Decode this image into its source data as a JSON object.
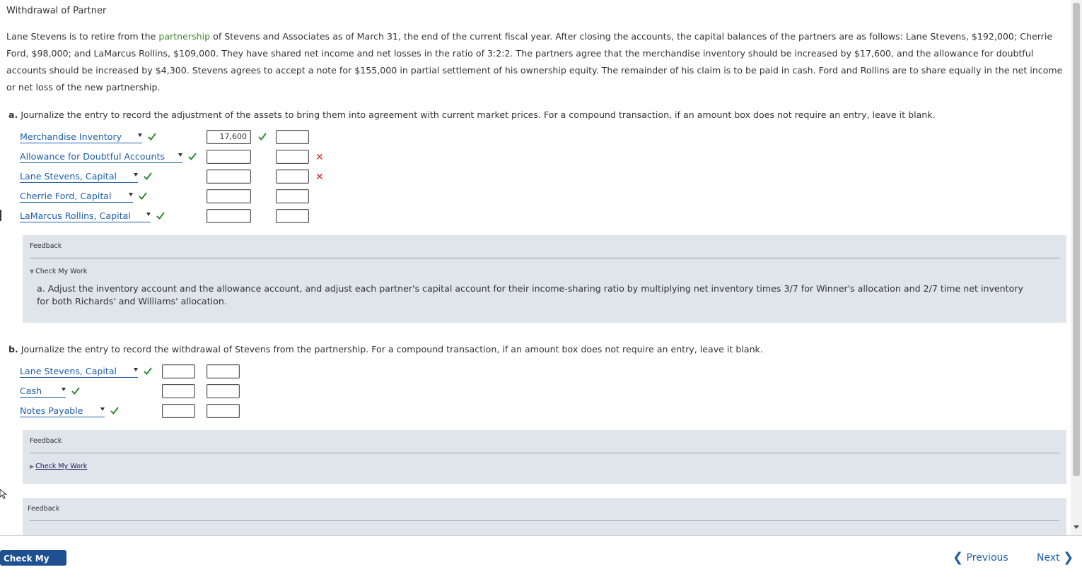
{
  "page": {
    "title": "Withdrawal of Partner",
    "intro_before": "Lane Stevens is to retire from the ",
    "intro_link": "partnership",
    "intro_after": " of Stevens and Associates as of March 31, the end of the current fiscal year. After closing the accounts, the capital balances of the partners are as follows: Lane Stevens, $192,000; Cherrie Ford, $98,000; and LaMarcus Rollins, $109,000. They have shared net income and net losses in the ratio of 3:2:2. The partners agree that the merchandise inventory should be increased by $17,600, and the allowance for doubtful accounts should be increased by $4,300. Stevens agrees to accept a note for $155,000 in partial settlement of his ownership equity. The remainder of his claim is to be paid in cash. Ford and Rollins are to share equally in the net income or net loss of the new partnership."
  },
  "part_a": {
    "letter": "a.",
    "prompt": "Journalize the entry to record the adjustment of the assets to bring them into agreement with current market prices. For a compound transaction, if an amount box does not require an entry, leave it blank.",
    "rows": [
      {
        "account": "Merchandise Inventory",
        "debit": "17,600",
        "credit": "",
        "debit_ok": true,
        "credit_wrong": false
      },
      {
        "account": "Allowance for Doubtful Accounts",
        "debit": "",
        "credit": "",
        "debit_ok": false,
        "credit_wrong": true
      },
      {
        "account": "Lane Stevens, Capital",
        "debit": "",
        "credit": "",
        "debit_ok": false,
        "credit_wrong": true
      },
      {
        "account": "Cherrie Ford, Capital",
        "debit": "",
        "credit": "",
        "debit_ok": false,
        "credit_wrong": false
      },
      {
        "account": "LaMarcus Rollins, Capital",
        "debit": "",
        "credit": "",
        "debit_ok": false,
        "credit_wrong": false
      }
    ],
    "feedback_label": "Feedback",
    "check_toggle": "Check My Work",
    "feedback_text": "a. Adjust the inventory account and the allowance account, and adjust each partner's capital account for their income-sharing ratio by multiplying net inventory times 3/7 for Winner's allocation and 2/7 time net inventory for both Richards' and Williams' allocation."
  },
  "part_b": {
    "letter": "b.",
    "prompt": "Journalize the entry to record the withdrawal of Stevens from the partnership. For a compound transaction, if an amount box does not require an entry, leave it blank.",
    "rows": [
      {
        "account": "Lane Stevens, Capital",
        "debit": "",
        "credit": ""
      },
      {
        "account": "Cash",
        "debit": "",
        "credit": ""
      },
      {
        "account": "Notes Payable",
        "debit": "",
        "credit": ""
      }
    ],
    "feedback_label": "Feedback",
    "check_toggle": "Check My Work"
  },
  "third_feedback": {
    "feedback_label": "Feedback"
  },
  "footer": {
    "check_button": "Check My Work",
    "previous": "Previous",
    "next": "Next"
  },
  "colors": {
    "link_green": "#3f8a2b",
    "select_blue": "#1f5fa8",
    "check_green": "#2e8b2e",
    "error_red": "#d9261c",
    "feedback_bg": "#dfe5ea",
    "button_blue": "#1d4f91"
  },
  "icons": {
    "correct": "checkmark-icon",
    "incorrect": "x-mark-icon",
    "dropdown": "caret-down-icon",
    "previous": "chevron-left-icon",
    "next": "chevron-right-icon"
  }
}
